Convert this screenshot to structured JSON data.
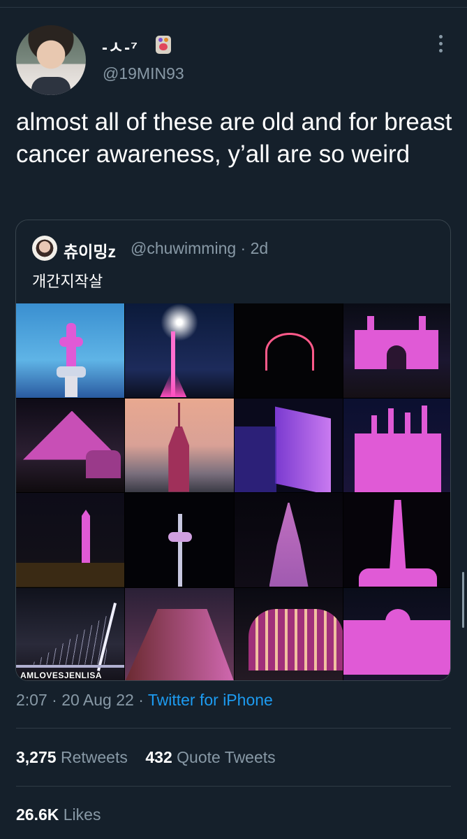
{
  "tweet": {
    "author_name": "-ㅅ-⁷",
    "author_handle": "@19MIN93",
    "text": "almost all of these are old and for breast cancer awareness, y’all are so weird",
    "timestamp": "2:07 · 20 Aug 22 · ",
    "source": "Twitter for iPhone"
  },
  "quote": {
    "author_name": "츄이밍z",
    "author_handle": "@chuwimming · 2d",
    "text": "개간지작살",
    "watermark": "AMLOVESJENLISA"
  },
  "stats": {
    "retweets_count": "3,275",
    "retweets_label": "Retweets",
    "quotes_count": "432",
    "quotes_label": "Quote Tweets",
    "likes_count": "26.6K",
    "likes_label": "Likes"
  },
  "colors": {
    "background": "#15202b",
    "muted_text": "#8899a6",
    "link": "#1d9bf0",
    "accent_pink": "#e05ad6"
  },
  "icons": {
    "more": "vertical-ellipsis-icon",
    "badge": "emoji-badge-icon"
  }
}
